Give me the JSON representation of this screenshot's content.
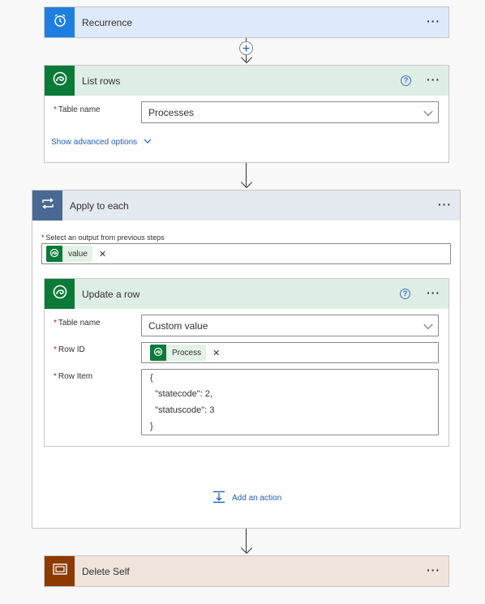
{
  "recurrence": {
    "title": "Recurrence",
    "more": "···"
  },
  "list_rows": {
    "title": "List rows",
    "help": "?",
    "more": "···",
    "table_name_label": "Table name",
    "table_name_value": "Processes",
    "advanced_link": "Show advanced options"
  },
  "apply_each": {
    "title": "Apply to each",
    "more": "···",
    "select_label": "Select an output from previous steps",
    "token_label": "value",
    "token_remove": "✕"
  },
  "update_row": {
    "title": "Update a row",
    "help": "?",
    "more": "···",
    "table_name_label": "Table name",
    "table_name_value": "Custom value",
    "row_id_label": "Row ID",
    "row_id_token": "Process",
    "token_remove": "✕",
    "row_item_label": "Row Item",
    "row_item_lines": [
      "{",
      "  \"statecode\": 2,",
      "  \"statuscode\": 3",
      "}"
    ]
  },
  "add_action": "Add an action",
  "delete_self": {
    "title": "Delete Self",
    "more": "···"
  },
  "colors": {
    "recurrence_icon": "#1f7fe0",
    "recurrence_header": "#deeafb",
    "dataverse_icon": "#0a7a38",
    "dataverse_header": "#dfeee4",
    "apply_icon": "#486991",
    "apply_header": "#e4e8ef",
    "delete_icon": "#8c3a00",
    "delete_header": "#efe3dc"
  }
}
